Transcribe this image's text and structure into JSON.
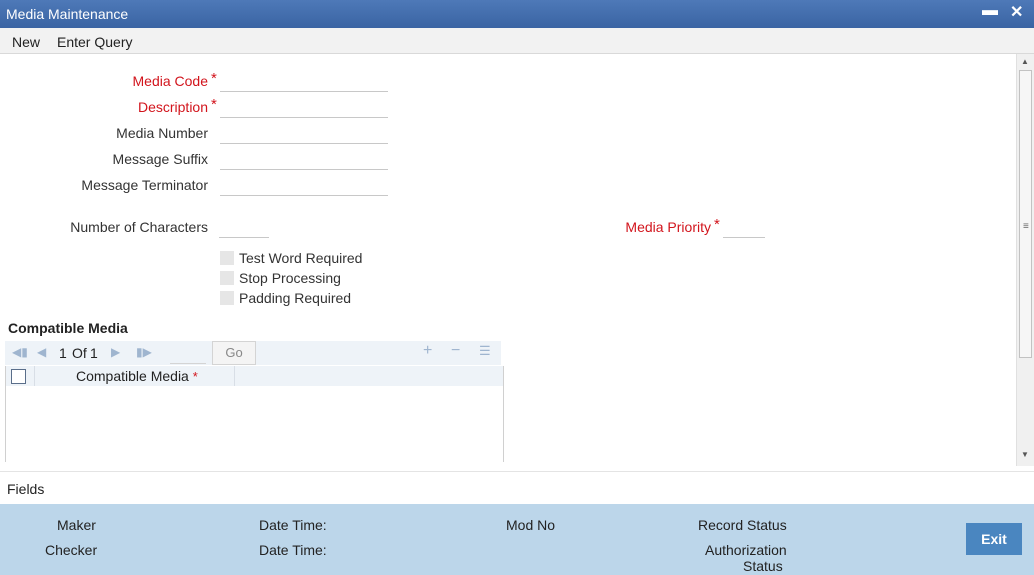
{
  "window": {
    "title": "Media Maintenance",
    "minimize_icon": "minimize-icon",
    "close_icon": "close-icon"
  },
  "toolbar": {
    "new_label": "New",
    "enter_query_label": "Enter Query"
  },
  "form": {
    "media_code_label": "Media Code",
    "description_label": "Description",
    "media_number_label": "Media Number",
    "message_suffix_label": "Message Suffix",
    "message_terminator_label": "Message Terminator",
    "number_of_characters_label": "Number of Characters",
    "media_priority_label": "Media Priority",
    "required_marker": "*",
    "media_code_value": "",
    "description_value": "",
    "media_number_value": "",
    "message_suffix_value": "",
    "message_terminator_value": "",
    "number_of_characters_value": "",
    "media_priority_value": ""
  },
  "options": {
    "test_word_required": {
      "label": "Test Word Required",
      "checked": false
    },
    "stop_processing": {
      "label": "Stop Processing",
      "checked": false
    },
    "padding_required": {
      "label": "Padding Required",
      "checked": false
    }
  },
  "compatible_media": {
    "section_title": "Compatible Media",
    "pager": {
      "current": "1",
      "of_label": "Of",
      "total": "1",
      "go_label": "Go"
    },
    "grid": {
      "column_header": "Compatible Media",
      "required_marker": "*",
      "rows": []
    }
  },
  "fields_bar": {
    "label": "Fields"
  },
  "audit": {
    "maker_label": "Maker",
    "checker_label": "Checker",
    "date_time_label_1": "Date Time:",
    "date_time_label_2": "Date Time:",
    "mod_no_label": "Mod No",
    "record_status_label": "Record Status",
    "authorization_label": "Authorization",
    "status_label": "Status",
    "exit_label": "Exit"
  },
  "colors": {
    "title_bar": "#3d67a6",
    "required_text": "#d2141c",
    "footer_bg": "#bcd6ea",
    "exit_button": "#4a86c0"
  }
}
